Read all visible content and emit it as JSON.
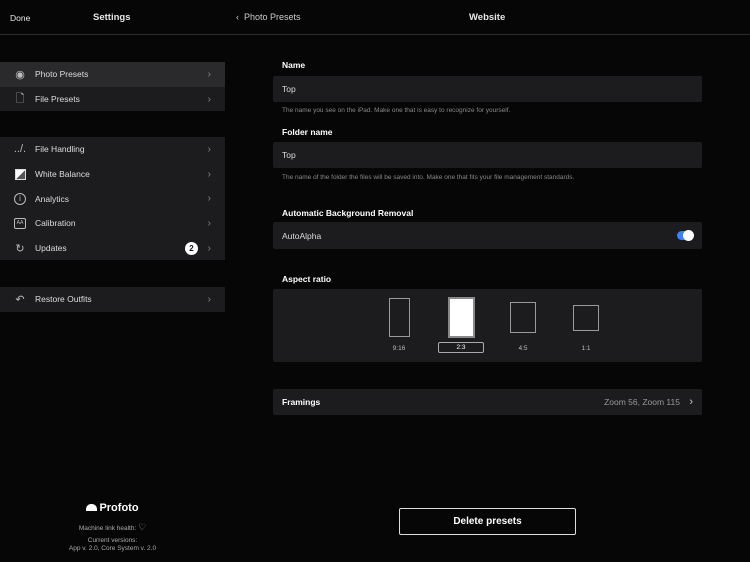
{
  "header": {
    "done": "Done",
    "title_left": "Settings",
    "back": "Photo Presets",
    "title_right": "Website"
  },
  "sidebar": {
    "group1": [
      {
        "label": "Photo Presets",
        "icon": "camera-icon"
      },
      {
        "label": "File Presets",
        "icon": "file-icon"
      }
    ],
    "group2": [
      {
        "label": "File Handling",
        "icon": "path-icon"
      },
      {
        "label": "White Balance",
        "icon": "white-balance-icon"
      },
      {
        "label": "Analytics",
        "icon": "info-icon"
      },
      {
        "label": "Calibration",
        "icon": "calibration-icon"
      },
      {
        "label": "Updates",
        "icon": "refresh-icon",
        "badge": "2"
      }
    ],
    "group3": [
      {
        "label": "Restore Outfits",
        "icon": "restore-icon"
      }
    ]
  },
  "footer": {
    "logo": "Profoto",
    "health": "Machine link health:",
    "versions_label": "Current versions:",
    "versions": "App v. 2.0, Core System v. 2.0"
  },
  "form": {
    "name_label": "Name",
    "name_value": "Top",
    "name_help": "The name you see on the iPad. Make one that is easy to recognize for yourself.",
    "folder_label": "Folder name",
    "folder_value": "Top",
    "folder_help": "The name of the folder the files will be saved into. Make one that fits your file management standards.",
    "abr_label": "Automatic Background Removal",
    "abr_option": "AutoAlpha",
    "abr_on": true,
    "aspect_label": "Aspect ratio",
    "aspect_options": [
      "9:16",
      "2:3",
      "4:5",
      "1:1"
    ],
    "aspect_selected": "2:3",
    "framings_label": "Framings",
    "framings_value": "Zoom 56, Zoom 115",
    "delete": "Delete presets"
  },
  "colors": {
    "toggle": "#3b82f6"
  }
}
